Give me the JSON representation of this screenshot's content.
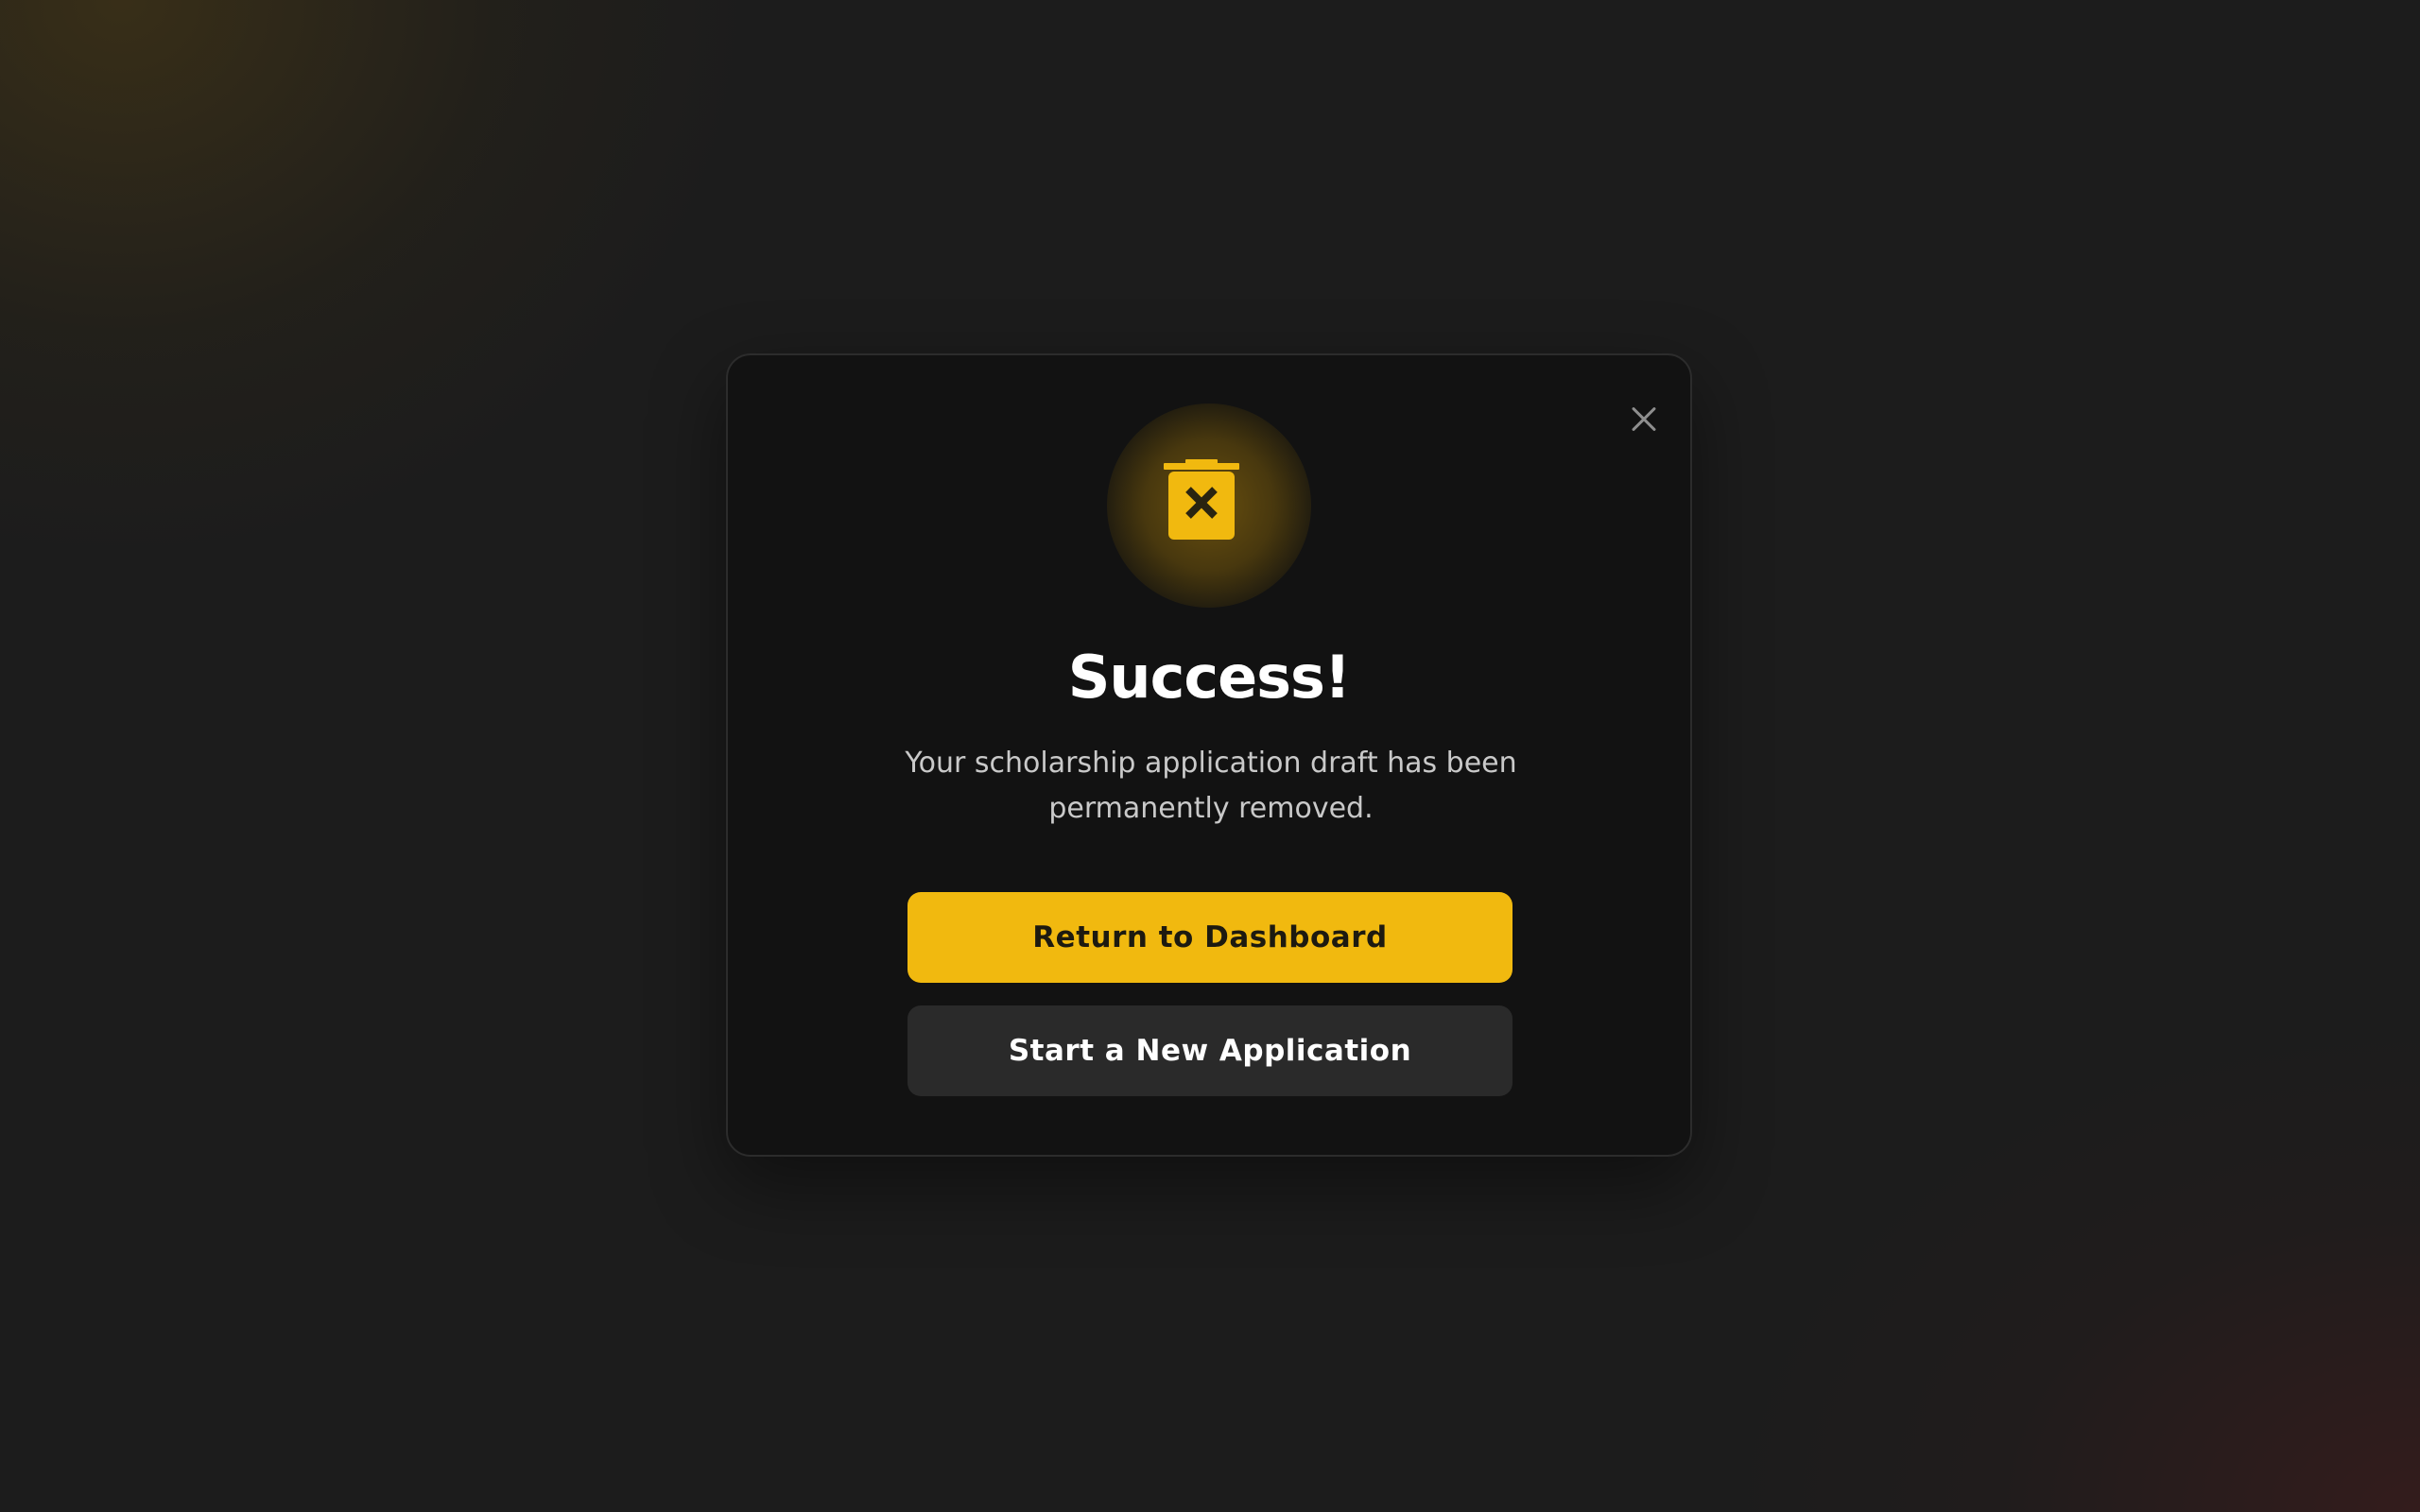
{
  "modal": {
    "title": "Success!",
    "message": "Your scholarship application draft has been permanently removed.",
    "primary_button_label": "Return to Dashboard",
    "secondary_button_label": "Start a New Application",
    "status_icon": "trash-x-icon",
    "close_icon": "close-icon"
  },
  "colors": {
    "accent": "#f1b90f",
    "background": "#1c1c1c",
    "modal_background": "#121212",
    "secondary_button": "#2a2a2a"
  }
}
